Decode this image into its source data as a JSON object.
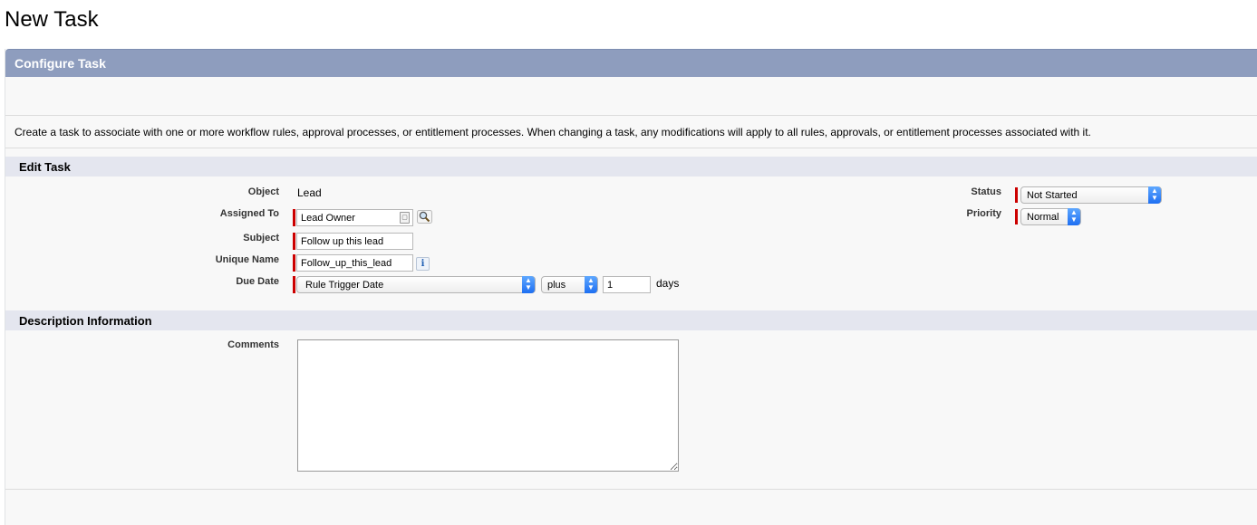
{
  "page": {
    "title": "New Task"
  },
  "configure": {
    "header": "Configure Task",
    "description": "Create a task to associate with one or more workflow rules, approval processes, or entitlement processes. When changing a task, any modifications will apply to all rules, approvals, or entitlement processes associated with it."
  },
  "edit_task": {
    "header": "Edit Task",
    "object_label": "Object",
    "object_value": "Lead",
    "assigned_to_label": "Assigned To",
    "assigned_to_value": "Lead Owner",
    "subject_label": "Subject",
    "subject_value": "Follow up this lead",
    "unique_name_label": "Unique Name",
    "unique_name_value": "Follow_up_this_lead",
    "due_date_label": "Due Date",
    "due_date_base": "Rule Trigger Date",
    "due_date_operator": "plus",
    "due_date_amount": "1",
    "due_date_unit": "days",
    "status_label": "Status",
    "status_value": "Not Started",
    "priority_label": "Priority",
    "priority_value": "Normal"
  },
  "description_info": {
    "header": "Description Information",
    "comments_label": "Comments",
    "comments_value": ""
  },
  "icons": {
    "lookup": "magnifier-lookup-icon",
    "info": "info-icon",
    "contact": "contact-card-icon",
    "select_arrows": "updown-arrows-icon"
  },
  "colors": {
    "header_bg": "#8e9dbe",
    "section_bg": "#e4e6ef",
    "required": "#cc0000",
    "select_arrow": "#1e6ff2"
  }
}
